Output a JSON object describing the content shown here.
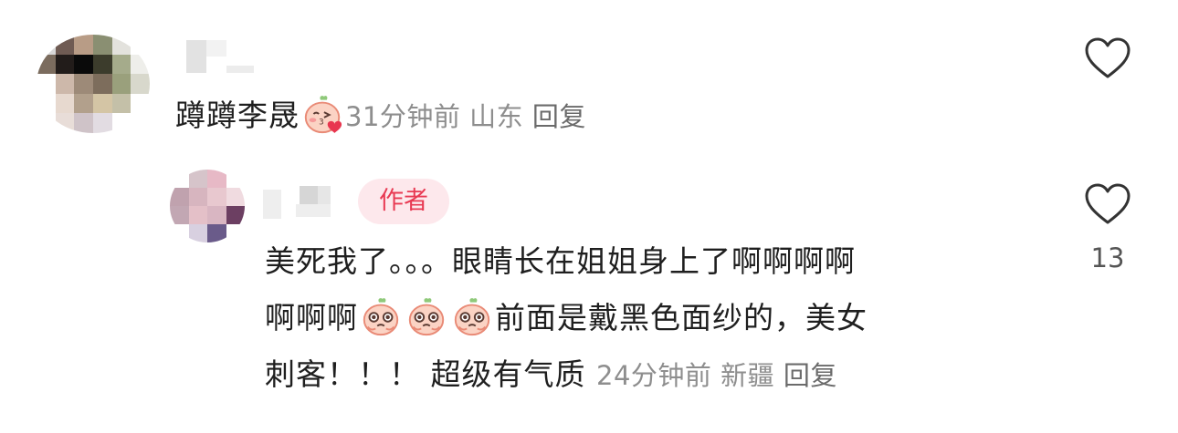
{
  "comment1": {
    "text": "蹲蹲李晟",
    "emoji": "kissing-peach-icon",
    "time": "31分钟前",
    "location": "山东",
    "reply_label": "回复",
    "like_count": ""
  },
  "comment2": {
    "badge": "作者",
    "text_part1": "美死我了。。。眼睛长在姐姐身上了啊啊啊啊",
    "text_part2": "啊啊啊",
    "emoji": "teary-peach-icon",
    "emoji_count": 3,
    "text_part3": "前面是戴黑色面纱的，美女",
    "text_part4": "刺客！！！ 超级有气质",
    "time": "24分钟前",
    "location": "新疆",
    "reply_label": "回复",
    "like_count": "13"
  },
  "colors": {
    "author_badge_bg": "#fde8ec",
    "author_badge_text": "#e83a53",
    "meta_text": "#8e8e8e"
  }
}
